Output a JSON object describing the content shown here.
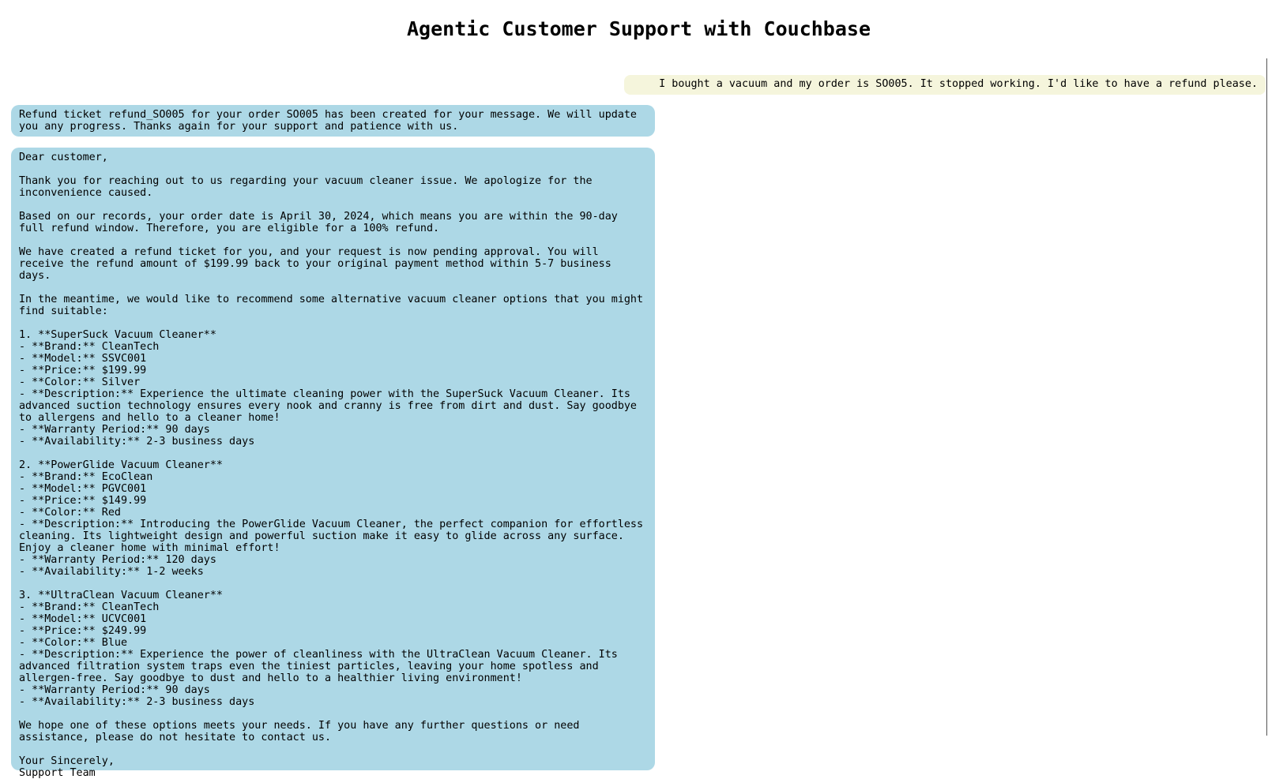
{
  "page": {
    "title": "Agentic Customer Support with Couchbase"
  },
  "chat": {
    "user_message": "I bought a vacuum and my order is SO005. It stopped working. I'd like to have a refund please.",
    "ticket_message": "Refund ticket refund_SO005 for your order SO005 has been created for your message. We will update you any progress. Thanks again for your support and patience with us.",
    "reply_message": "Dear customer,\n\nThank you for reaching out to us regarding your vacuum cleaner issue. We apologize for the inconvenience caused.\n\nBased on our records, your order date is April 30, 2024, which means you are within the 90-day full refund window. Therefore, you are eligible for a 100% refund.\n\nWe have created a refund ticket for you, and your request is now pending approval. You will receive the refund amount of $199.99 back to your original payment method within 5-7 business days.\n\nIn the meantime, we would like to recommend some alternative vacuum cleaner options that you might find suitable:\n\n1. **SuperSuck Vacuum Cleaner**\n- **Brand:** CleanTech\n- **Model:** SSVC001\n- **Price:** $199.99\n- **Color:** Silver\n- **Description:** Experience the ultimate cleaning power with the SuperSuck Vacuum Cleaner. Its advanced suction technology ensures every nook and cranny is free from dirt and dust. Say goodbye to allergens and hello to a cleaner home!\n- **Warranty Period:** 90 days\n- **Availability:** 2-3 business days\n\n2. **PowerGlide Vacuum Cleaner**\n- **Brand:** EcoClean\n- **Model:** PGVC001\n- **Price:** $149.99\n- **Color:** Red\n- **Description:** Introducing the PowerGlide Vacuum Cleaner, the perfect companion for effortless cleaning. Its lightweight design and powerful suction make it easy to glide across any surface. Enjoy a cleaner home with minimal effort!\n- **Warranty Period:** 120 days\n- **Availability:** 1-2 weeks\n\n3. **UltraClean Vacuum Cleaner**\n- **Brand:** CleanTech\n- **Model:** UCVC001\n- **Price:** $249.99\n- **Color:** Blue\n- **Description:** Experience the power of cleanliness with the UltraClean Vacuum Cleaner. Its advanced filtration system traps even the tiniest particles, leaving your home spotless and allergen-free. Say goodbye to dust and hello to a healthier living environment!\n- **Warranty Period:** 90 days\n- **Availability:** 2-3 business days\n\nWe hope one of these options meets your needs. If you have any further questions or need assistance, please do not hesitate to contact us.\n\nYour Sincerely,\nSupport Team"
  },
  "colors": {
    "user_bubble": "#f5f5dc",
    "bot_bubble": "#add8e6",
    "background": "#ffffff"
  }
}
